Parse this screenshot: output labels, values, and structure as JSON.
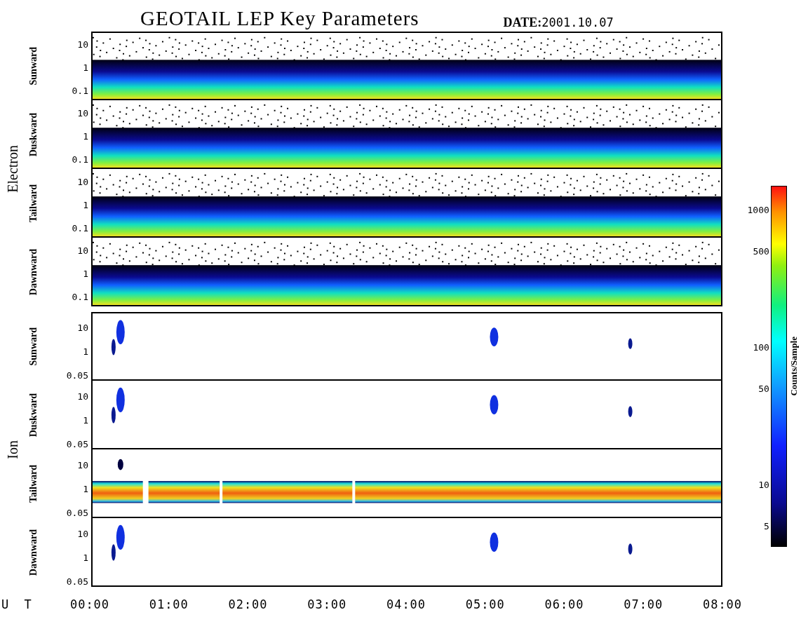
{
  "title": "GEOTAIL LEP Key Parameters",
  "date": {
    "label": "DATE:",
    "value": "2001.10.07"
  },
  "groups": [
    {
      "species": "Electron",
      "panels": [
        {
          "direction": "Sunward",
          "kind": "electron-band",
          "yticks": [
            "10",
            "1",
            "0.1"
          ]
        },
        {
          "direction": "Duskward",
          "kind": "electron-band",
          "yticks": [
            "10",
            "1",
            "0.1"
          ]
        },
        {
          "direction": "Tailward",
          "kind": "electron-band",
          "yticks": [
            "10",
            "1",
            "0.1"
          ]
        },
        {
          "direction": "Dawnward",
          "kind": "electron-band",
          "yticks": [
            "10",
            "1",
            "0.1"
          ]
        }
      ]
    },
    {
      "species": "Ion",
      "panels": [
        {
          "direction": "Sunward",
          "kind": "ion-bursts",
          "yticks": [
            "10",
            "1",
            "0.05"
          ]
        },
        {
          "direction": "Duskward",
          "kind": "ion-bursts",
          "yticks": [
            "10",
            "1",
            "0.05"
          ]
        },
        {
          "direction": "Tailward",
          "kind": "ion-band",
          "yticks": [
            "10",
            "1",
            "0.05"
          ]
        },
        {
          "direction": "Dawnward",
          "kind": "ion-bursts",
          "yticks": [
            "10",
            "1",
            "0.05"
          ]
        }
      ]
    }
  ],
  "time_axis": {
    "label": "U T",
    "ticks": [
      "00:00",
      "01:00",
      "02:00",
      "03:00",
      "04:00",
      "05:00",
      "06:00",
      "07:00",
      "08:00"
    ]
  },
  "colorbar": {
    "title": "Counts/Sample",
    "ticks": [
      "1000",
      "500",
      "100",
      "50",
      "10",
      "5"
    ]
  }
}
